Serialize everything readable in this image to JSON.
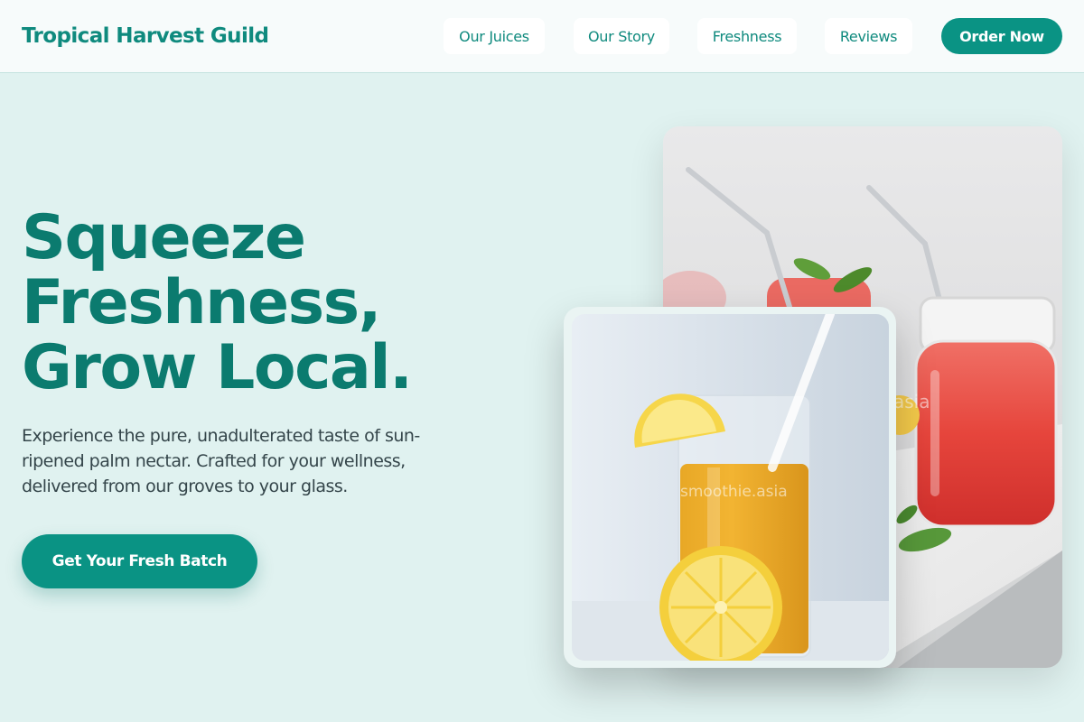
{
  "header": {
    "brand": "Tropical Harvest Guild",
    "nav": [
      "Our Juices",
      "Our Story",
      "Freshness",
      "Reviews"
    ],
    "cta": "Order Now"
  },
  "hero": {
    "title_lines": [
      "Squeeze",
      "Freshness,",
      "Grow Local."
    ],
    "description": "Experience the pure, unadulterated taste of sun-ripened palm nectar. Crafted for your wellness, delivered from our groves to your glass.",
    "cta": "Get Your Fresh Batch"
  },
  "images": {
    "back": "red-smoothie-jars-photo",
    "front": "orange-juice-glass-photo",
    "watermark_back": "asia",
    "watermark_front": "smoothie.asia"
  },
  "colors": {
    "accent": "#0a9384",
    "heading": "#0b7b6f",
    "background": "#e0f2f0"
  }
}
